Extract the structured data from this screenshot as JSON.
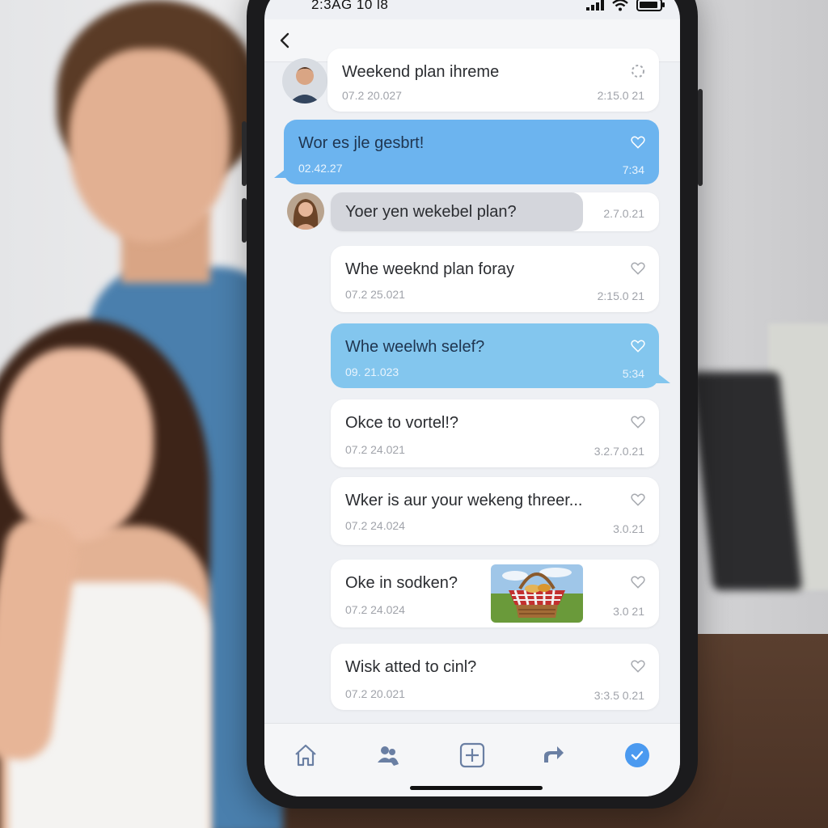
{
  "status_bar": {
    "time": "2:3AG 10 l8"
  },
  "header": {
    "back_icon": "chevron-left-icon"
  },
  "messages": [
    {
      "title": "Weekend plan ihreme",
      "date": "07.2 20.027",
      "time": "2:15.0 21",
      "style": "white",
      "status_icon": "loading-icon"
    },
    {
      "title": "Wor es jle gesbrt!",
      "date": "02.42.27",
      "time": "7:34",
      "style": "blue",
      "status_icon": "heart-icon"
    },
    {
      "title": "Yoer yen wekebel plan?",
      "date": "",
      "time": "2.7.0.21",
      "style": "gray"
    },
    {
      "title": "Whe weeknd plan foray",
      "date": "07.2 25.021",
      "time": "2:15.0 21",
      "style": "white",
      "status_icon": "heart-icon"
    },
    {
      "title": "Whe weelwh selef?",
      "date": "09. 21.023",
      "time": "5:34",
      "style": "lightblue",
      "status_icon": "heart-icon"
    },
    {
      "title": "Okce to vortel!?",
      "date": "07.2 24.021",
      "time": "3.2.7.0.21",
      "style": "white",
      "status_icon": "heart-icon"
    },
    {
      "title": "Wker is aur your wekeng threer...",
      "date": "07.2 24.024",
      "time": "3.0.21",
      "style": "white",
      "status_icon": "heart-icon"
    },
    {
      "title": "Oke in sodken?",
      "date": "07.2 24.024",
      "time": "3.0 21",
      "style": "white",
      "status_icon": "heart-icon",
      "image": "picnic-basket-image"
    },
    {
      "title": "Wisk atted to cinl?",
      "date": "07.2 20.021",
      "time": "3:3.5 0.21",
      "style": "white",
      "status_icon": "heart-icon"
    }
  ],
  "tab_bar": {
    "tabs": [
      {
        "name": "home",
        "icon": "home-icon"
      },
      {
        "name": "people",
        "icon": "people-icon"
      },
      {
        "name": "add",
        "icon": "add-icon"
      },
      {
        "name": "share",
        "icon": "share-icon"
      },
      {
        "name": "done",
        "icon": "check-circle-icon",
        "active": true
      }
    ]
  },
  "colors": {
    "accent_blue": "#6cb4ef",
    "light_blue": "#83c6ee",
    "active_tab": "#4b9af0"
  }
}
